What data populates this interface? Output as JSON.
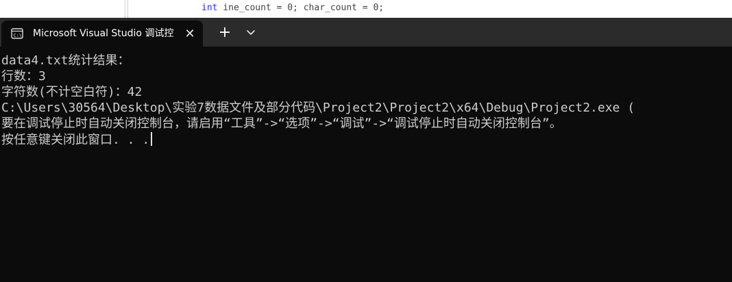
{
  "background_editor": {
    "code_fragment": "int",
    "code_rest": " ine_count = 0; char_count = 0;"
  },
  "tab": {
    "title": "Microsoft Visual Studio 调试控",
    "icon": "terminal-icon",
    "close_glyph": "✕"
  },
  "toolbar": {
    "new_tab_glyph": "+",
    "dropdown_icon": "chevron-down-icon"
  },
  "console": {
    "lines": [
      "data4.txt统计结果：",
      "行数：3",
      "字符数(不计空白符)：42",
      "C:\\Users\\30564\\Desktop\\实验7数据文件及部分代码\\Project2\\Project2\\x64\\Debug\\Project2.exe (",
      "要在调试停止时自动关闭控制台，请启用“工具”->“选项”->“调试”->“调试停止时自动关闭控制台”。",
      "按任意键关闭此窗口. . ."
    ]
  },
  "colors": {
    "console_bg": "#0c0c0c",
    "console_text": "#cccccc",
    "tabbar_bg": "#2b2b2b",
    "tab_active_bg": "#0c0c0c"
  }
}
